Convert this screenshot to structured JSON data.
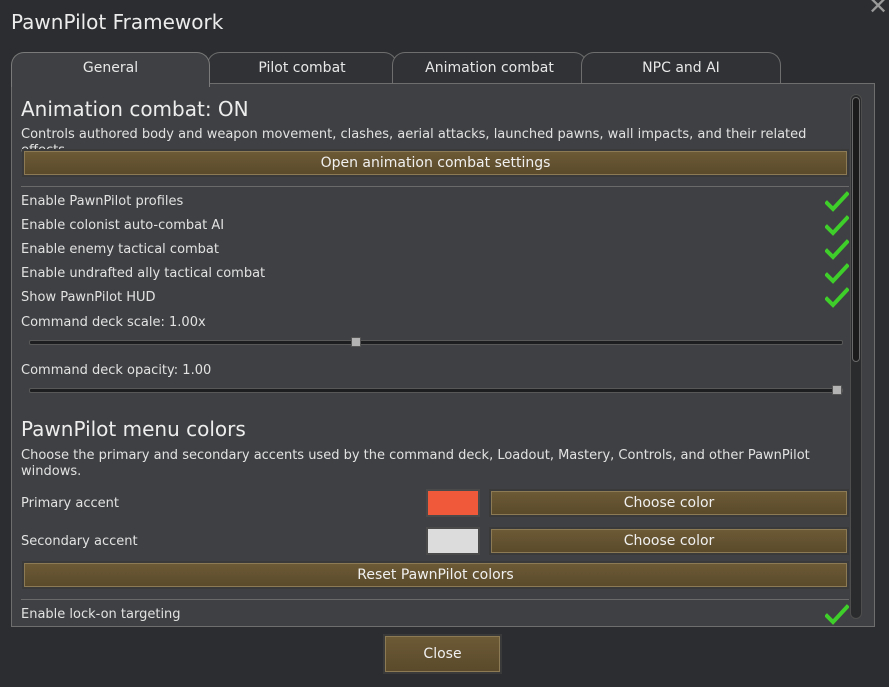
{
  "window": {
    "title": "PawnPilot Framework",
    "close_glyph": "✕"
  },
  "tabs": [
    {
      "label": "General",
      "active": true
    },
    {
      "label": "Pilot combat",
      "active": false
    },
    {
      "label": "Animation combat",
      "active": false
    },
    {
      "label": "NPC and AI",
      "active": false
    }
  ],
  "animation_section": {
    "heading": "Animation combat: ON",
    "description": "Controls authored body and weapon movement, clashes, aerial attacks, launched pawns, wall impacts, and their related effects.",
    "settings_button": "Open animation combat settings"
  },
  "toggles": [
    {
      "label": "Enable PawnPilot profiles",
      "checked": true
    },
    {
      "label": "Enable colonist auto-combat AI",
      "checked": true
    },
    {
      "label": "Enable enemy tactical combat",
      "checked": true
    },
    {
      "label": "Enable undrafted ally tactical combat",
      "checked": true
    },
    {
      "label": "Show PawnPilot HUD",
      "checked": true
    }
  ],
  "sliders": [
    {
      "label": "Command deck scale: 1.00x",
      "fraction": 0.4
    },
    {
      "label": "Command deck opacity: 1.00",
      "fraction": 1.0
    }
  ],
  "colors_section": {
    "heading": "PawnPilot menu colors",
    "description": "Choose the primary and secondary accents used by the command deck, Loadout, Mastery, Controls, and other PawnPilot windows.",
    "primary_label": "Primary accent",
    "primary_color": "#f05a3a",
    "secondary_label": "Secondary accent",
    "secondary_color": "#dcdcdc",
    "choose_label": "Choose color",
    "reset_label": "Reset PawnPilot colors"
  },
  "partial_row": {
    "label": "Enable lock-on targeting",
    "checked": true
  },
  "footer": {
    "close_label": "Close"
  },
  "colors": {
    "check": "#3fcf2a",
    "button": "#6d5a36",
    "panel": "#3e4043"
  }
}
